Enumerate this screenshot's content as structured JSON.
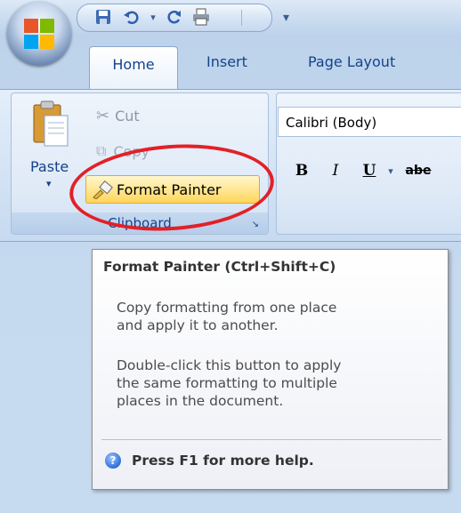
{
  "quick_access": {
    "items": [
      "save-icon",
      "undo-icon",
      "redo-icon",
      "print-icon"
    ],
    "customize": "▾"
  },
  "tabs": [
    "Home",
    "Insert",
    "Page Layout"
  ],
  "clipboard": {
    "paste": "Paste",
    "cut": "Cut",
    "copy": "Copy",
    "format_painter": "Format Painter",
    "group_label": "Clipboard"
  },
  "font": {
    "name": "Calibri (Body)",
    "bold": "B",
    "italic": "I",
    "underline": "U",
    "strikethrough": "abe"
  },
  "tooltip": {
    "title": "Format Painter (Ctrl+Shift+C)",
    "line1": "Copy formatting from one place",
    "line2": "and apply it to another.",
    "line3": "Double-click this button to apply",
    "line4": "the same formatting to multiple",
    "line5": "places in the document.",
    "help": "Press F1 for more help."
  },
  "colors": {
    "accent": "#15428b",
    "highlight": "#e32027"
  }
}
